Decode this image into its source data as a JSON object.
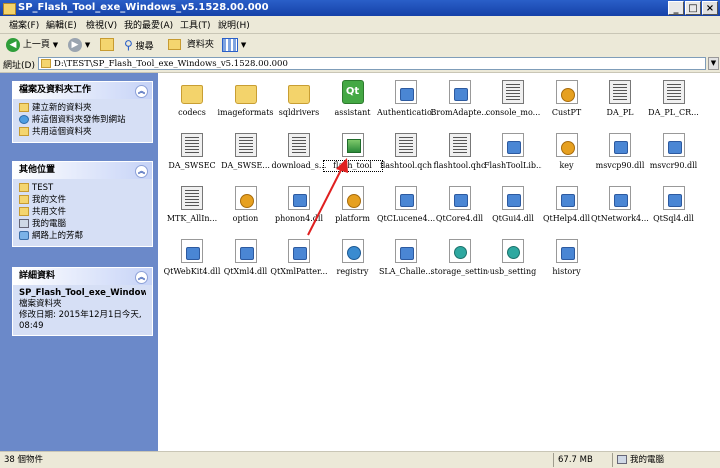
{
  "window": {
    "title": "SP_Flash_Tool_exe_Windows_v5.1528.00.000",
    "controls": [
      "_",
      "□",
      "×"
    ]
  },
  "menu": [
    "檔案(F)",
    "編輯(E)",
    "檢視(V)",
    "我的最愛(A)",
    "工具(T)",
    "說明(H)"
  ],
  "toolbar": {
    "back": "上一頁",
    "search": "搜尋",
    "folders": "資料夾"
  },
  "address": {
    "label": "網址(D)",
    "value": "D:\\TEST\\SP_Flash_Tool_exe_Windows_v5.1528.00.000"
  },
  "tasks_panel": {
    "title": "檔案及資料夾工作",
    "items": [
      {
        "label": "建立新的資料夾",
        "icon": "new-folder-icon"
      },
      {
        "label": "將這個資料夾發佈到網站",
        "icon": "publish-web-icon"
      },
      {
        "label": "共用這個資料夾",
        "icon": "share-folder-icon"
      }
    ]
  },
  "places_panel": {
    "title": "其他位置",
    "items": [
      {
        "label": "TEST",
        "icon": "folder-icon"
      },
      {
        "label": "我的文件",
        "icon": "documents-icon"
      },
      {
        "label": "共用文件",
        "icon": "shared-documents-icon"
      },
      {
        "label": "我的電腦",
        "icon": "my-computer-icon"
      },
      {
        "label": "網路上的芳鄰",
        "icon": "network-places-icon"
      }
    ]
  },
  "details_panel": {
    "title": "詳細資料",
    "name": "SP_Flash_Tool_exe_Windows_",
    "type": "檔案資料夾",
    "modified": "修改日期: 2015年12月1日今天, 08:49"
  },
  "files": [
    {
      "name": "codecs",
      "icon": "folder-icon"
    },
    {
      "name": "imageformats",
      "icon": "folder-icon"
    },
    {
      "name": "sqldrivers",
      "icon": "folder-icon"
    },
    {
      "name": "assistant",
      "icon": "qt-icon"
    },
    {
      "name": "Authenticatio...",
      "icon": "dll-icon"
    },
    {
      "name": "BromAdapte...",
      "icon": "dll-icon"
    },
    {
      "name": "console_mo...",
      "icon": "file-icon"
    },
    {
      "name": "CustPT",
      "icon": "gear-file-icon"
    },
    {
      "name": "DA_PL",
      "icon": "file-icon"
    },
    {
      "name": "DA_PL_CR...",
      "icon": "file-icon"
    },
    {
      "name": "DA_SWSEC",
      "icon": "file-icon"
    },
    {
      "name": "DA_SWSE...",
      "icon": "file-icon"
    },
    {
      "name": "download_s...",
      "icon": "file-icon"
    },
    {
      "name": "flash_tool",
      "icon": "flash-tool-icon"
    },
    {
      "name": "flashtool.qch",
      "icon": "file-icon"
    },
    {
      "name": "flashtool.qhc",
      "icon": "file-icon"
    },
    {
      "name": "FlashToolLib...",
      "icon": "dll-icon"
    },
    {
      "name": "key",
      "icon": "gear-file-icon"
    },
    {
      "name": "msvcp90.dll",
      "icon": "dll-icon"
    },
    {
      "name": "msvcr90.dll",
      "icon": "dll-icon"
    },
    {
      "name": "MTK_AllIn...",
      "icon": "file-icon"
    },
    {
      "name": "option",
      "icon": "gear-file-icon"
    },
    {
      "name": "phonon4.dll",
      "icon": "dll-icon"
    },
    {
      "name": "platform",
      "icon": "gear-file-icon"
    },
    {
      "name": "QtCLucene4....",
      "icon": "dll-icon"
    },
    {
      "name": "QtCore4.dll",
      "icon": "dll-icon"
    },
    {
      "name": "QtGui4.dll",
      "icon": "dll-icon"
    },
    {
      "name": "QtHelp4.dll",
      "icon": "dll-icon"
    },
    {
      "name": "QtNetwork4....",
      "icon": "dll-icon"
    },
    {
      "name": "QtSql4.dll",
      "icon": "dll-icon"
    },
    {
      "name": "QtWebKit4.dll",
      "icon": "dll-icon"
    },
    {
      "name": "QtXml4.dll",
      "icon": "dll-icon"
    },
    {
      "name": "QtXmlPatter...",
      "icon": "dll-icon"
    },
    {
      "name": "registry",
      "icon": "registry-icon"
    },
    {
      "name": "SLA_Challe...",
      "icon": "dll-icon"
    },
    {
      "name": "storage_setting",
      "icon": "settings-file-icon"
    },
    {
      "name": "usb_setting",
      "icon": "settings-file-icon"
    },
    {
      "name": "history",
      "icon": "dll-icon"
    }
  ],
  "status": {
    "count": "38 個物件",
    "size": "67.7 MB",
    "location": "我的電腦"
  }
}
